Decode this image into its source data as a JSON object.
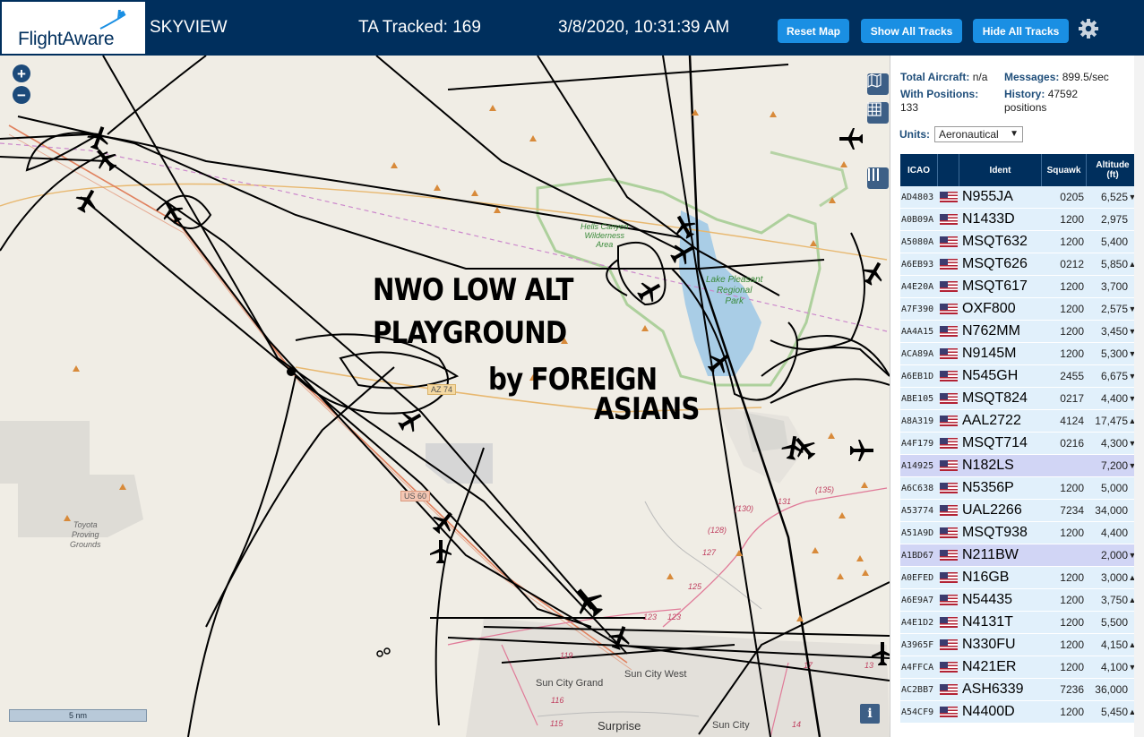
{
  "header": {
    "logo_text": "FlightAware",
    "app_name": "SKYVIEW",
    "tracked": "TA Tracked: 169",
    "datetime": "3/8/2020, 10:31:39 AM",
    "reset_map": "Reset Map",
    "show_all_tracks": "Show All Tracks",
    "hide_all_tracks": "Hide All Tracks"
  },
  "map": {
    "zoom_in": "+",
    "zoom_out": "−",
    "scale": "5 nm",
    "info": "i",
    "overlay_line1": "NWO LOW ALT",
    "overlay_line2": "PLAYGROUND",
    "overlay_line3": "by FOREIGN",
    "overlay_line4": "ASIANS",
    "labels": {
      "hells_canyon_1": "Hells Canyon",
      "hells_canyon_2": "Wilderness",
      "hells_canyon_3": "Area",
      "lake_1": "Lake Pleasant",
      "lake_2": "Regional",
      "lake_3": "Park",
      "az74": "AZ 74",
      "us60": "US 60",
      "toyota_1": "Toyota",
      "toyota_2": "Proving",
      "toyota_3": "Grounds",
      "sun_city_west": "Sun City West",
      "sun_city_grand": "Sun City Grand",
      "surprise": "Surprise",
      "sun_city": "Sun City",
      "r135": "(135)",
      "r131": "131",
      "r130": "(130)",
      "r128": "(128)",
      "r127": "127",
      "r125": "125",
      "r123a": "123",
      "r123b": "123",
      "r119": "119",
      "r116": "116",
      "r115": "115",
      "r17": "17",
      "r13": "13",
      "r14": "14"
    }
  },
  "sidebar": {
    "total_aircraft_label": "Total Aircraft:",
    "total_aircraft_value": "n/a",
    "messages_label": "Messages:",
    "messages_value": "899.5/sec",
    "with_positions_label": "With Positions:",
    "with_positions_value": "133",
    "history_label": "History:",
    "history_value": "47592",
    "history_unit": "positions",
    "units_label": "Units:",
    "units_value": "Aeronautical",
    "columns": {
      "icao": "ICAO",
      "flag": "",
      "ident": "Ident",
      "squawk": "Squawk",
      "altitude_1": "Altitude",
      "altitude_2": "(ft)"
    },
    "rows": [
      {
        "icao": "AD4803",
        "ident": "N955JA",
        "squawk": "0205",
        "alt": "6,525",
        "trend": "▼",
        "sel": false
      },
      {
        "icao": "A0B09A",
        "ident": "N1433D",
        "squawk": "1200",
        "alt": "2,975",
        "trend": "",
        "sel": false
      },
      {
        "icao": "A5080A",
        "ident": "MSQT632",
        "squawk": "1200",
        "alt": "5,400",
        "trend": "",
        "sel": false
      },
      {
        "icao": "A6EB93",
        "ident": "MSQT626",
        "squawk": "0212",
        "alt": "5,850",
        "trend": "▲",
        "sel": false
      },
      {
        "icao": "A4E20A",
        "ident": "MSQT617",
        "squawk": "1200",
        "alt": "3,700",
        "trend": "",
        "sel": false
      },
      {
        "icao": "A7F390",
        "ident": "OXF800",
        "squawk": "1200",
        "alt": "2,575",
        "trend": "▼",
        "sel": false
      },
      {
        "icao": "AA4A15",
        "ident": "N762MM",
        "squawk": "1200",
        "alt": "3,450",
        "trend": "▼",
        "sel": false
      },
      {
        "icao": "ACA89A",
        "ident": "N9145M",
        "squawk": "1200",
        "alt": "5,300",
        "trend": "▼",
        "sel": false
      },
      {
        "icao": "A6EB1D",
        "ident": "N545GH",
        "squawk": "2455",
        "alt": "6,675",
        "trend": "▼",
        "sel": false
      },
      {
        "icao": "ABE105",
        "ident": "MSQT824",
        "squawk": "0217",
        "alt": "4,400",
        "trend": "▼",
        "sel": false
      },
      {
        "icao": "A8A319",
        "ident": "AAL2722",
        "squawk": "4124",
        "alt": "17,475",
        "trend": "▲",
        "sel": false
      },
      {
        "icao": "A4F179",
        "ident": "MSQT714",
        "squawk": "0216",
        "alt": "4,300",
        "trend": "▼",
        "sel": false
      },
      {
        "icao": "A14925",
        "ident": "N182LS",
        "squawk": "",
        "alt": "7,200",
        "trend": "▼",
        "sel": true
      },
      {
        "icao": "A6C638",
        "ident": "N5356P",
        "squawk": "1200",
        "alt": "5,000",
        "trend": "",
        "sel": false
      },
      {
        "icao": "A53774",
        "ident": "UAL2266",
        "squawk": "7234",
        "alt": "34,000",
        "trend": "",
        "sel": false
      },
      {
        "icao": "A51A9D",
        "ident": "MSQT938",
        "squawk": "1200",
        "alt": "4,400",
        "trend": "",
        "sel": false
      },
      {
        "icao": "A1BD67",
        "ident": "N211BW",
        "squawk": "",
        "alt": "2,000",
        "trend": "▼",
        "sel": true
      },
      {
        "icao": "A0EFED",
        "ident": "N16GB",
        "squawk": "1200",
        "alt": "3,000",
        "trend": "▲",
        "sel": false
      },
      {
        "icao": "A6E9A7",
        "ident": "N54435",
        "squawk": "1200",
        "alt": "3,750",
        "trend": "▲",
        "sel": false
      },
      {
        "icao": "A4E1D2",
        "ident": "N4131T",
        "squawk": "1200",
        "alt": "5,500",
        "trend": "",
        "sel": false
      },
      {
        "icao": "A3965F",
        "ident": "N330FU",
        "squawk": "1200",
        "alt": "4,150",
        "trend": "▲",
        "sel": false
      },
      {
        "icao": "A4FFCA",
        "ident": "N421ER",
        "squawk": "1200",
        "alt": "4,100",
        "trend": "▼",
        "sel": false
      },
      {
        "icao": "AC2BB7",
        "ident": "ASH6339",
        "squawk": "7236",
        "alt": "36,000",
        "trend": "",
        "sel": false
      },
      {
        "icao": "A54CF9",
        "ident": "N4400D",
        "squawk": "1200",
        "alt": "5,450",
        "trend": "▲",
        "sel": false
      }
    ]
  }
}
